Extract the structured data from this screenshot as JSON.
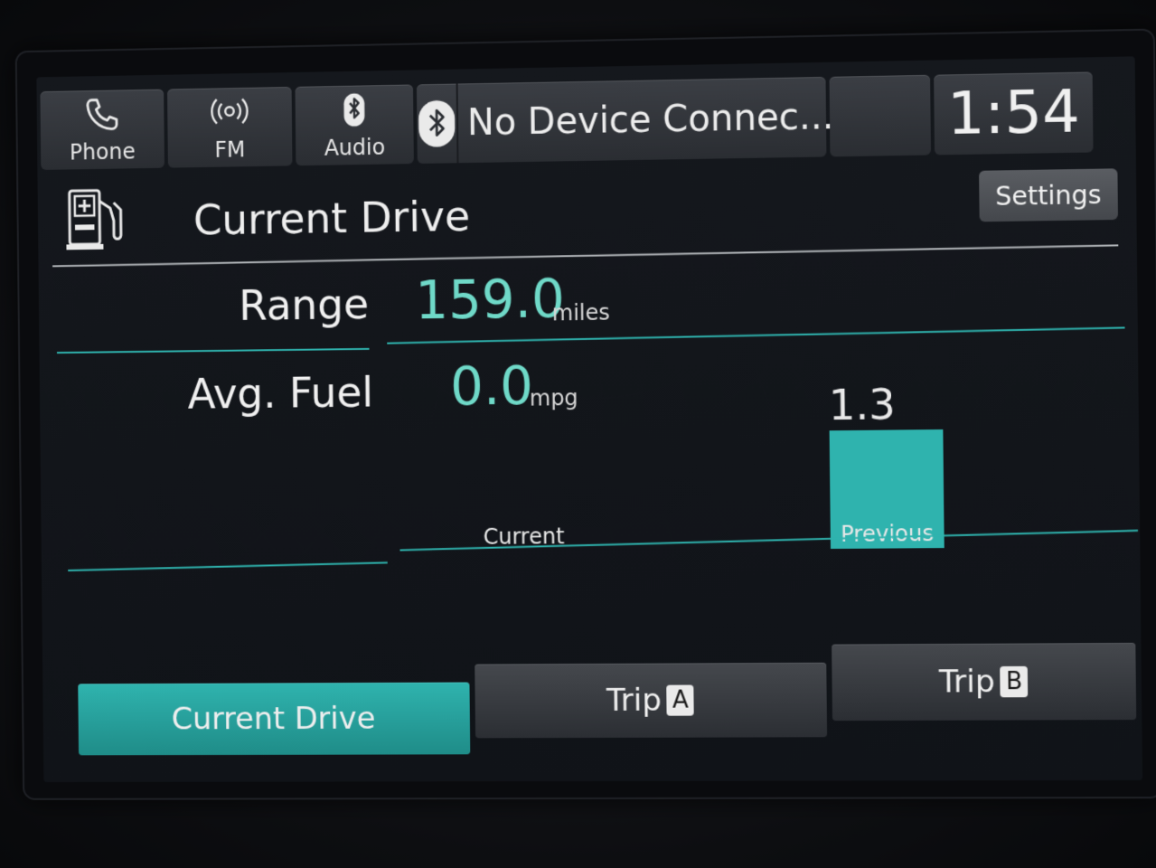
{
  "topbar": {
    "phone": {
      "label": "Phone",
      "icon": "phone-icon"
    },
    "fm": {
      "label": "FM",
      "icon": "radio-antenna-icon"
    },
    "audio": {
      "label": "Audio",
      "icon": "bluetooth-audio-icon"
    },
    "bluetooth": {
      "icon": "bluetooth-icon",
      "status": "No Device Connec..."
    },
    "clock": "1:54"
  },
  "header": {
    "icon": "fuel-pump-icon",
    "title": "Current Drive",
    "settings_label": "Settings"
  },
  "range": {
    "label": "Range",
    "value": "159.0",
    "unit": "miles"
  },
  "avg_fuel": {
    "label": "Avg. Fuel",
    "value": "0.0",
    "unit": "mpg"
  },
  "chart_data": {
    "type": "bar",
    "categories": [
      "Current",
      "Previous"
    ],
    "values": [
      0.0,
      1.3
    ],
    "value_labels": [
      "",
      "1.3"
    ],
    "max": 1.3,
    "bar_color": "#2fb3ae"
  },
  "tabs": [
    {
      "label": "Current Drive",
      "tag": "",
      "active": true
    },
    {
      "label": "Trip",
      "tag": "A",
      "active": false
    },
    {
      "label": "Trip",
      "tag": "B",
      "active": false
    }
  ],
  "colors": {
    "accent": "#2fb3ae",
    "value_text": "#6fd9c8"
  }
}
